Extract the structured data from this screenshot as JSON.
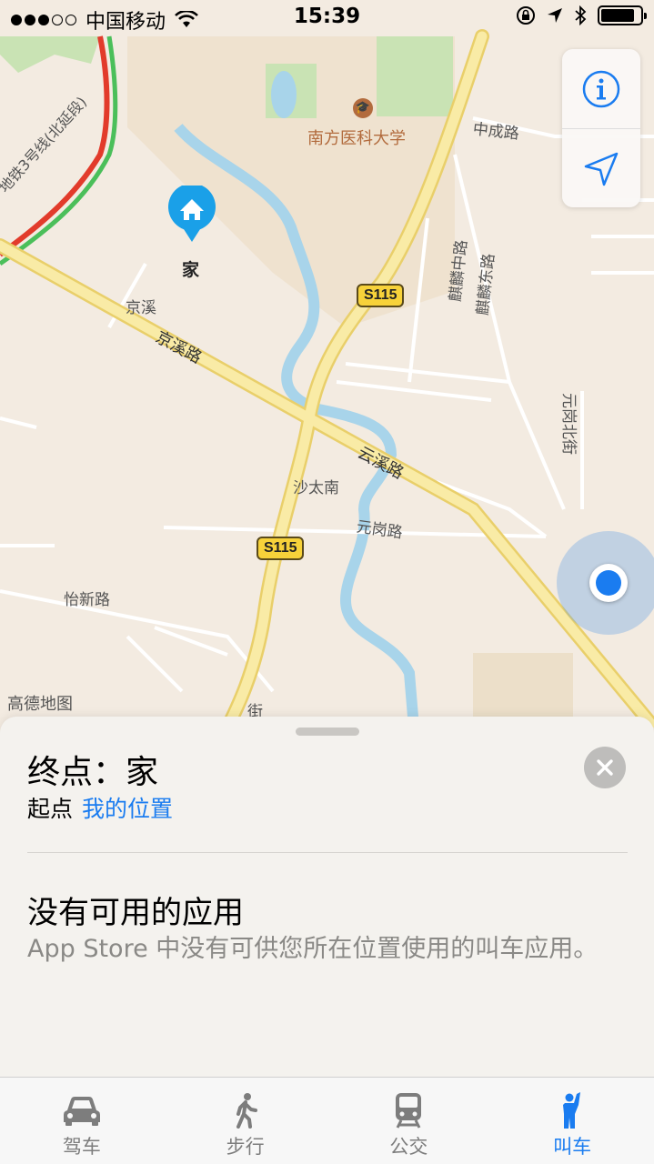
{
  "status_bar": {
    "carrier": "中国移动",
    "time": "15:39",
    "signal_full": 3,
    "signal_total": 5,
    "battery_level": 0.85
  },
  "map": {
    "labels": {
      "university": "南方医科大学",
      "zhongcheng_rd": "中成路",
      "metro_line": "地铁3号线(北延段)",
      "jingxi": "京溪",
      "jingxi_rd": "京溪路",
      "yunxi_rd": "云溪路",
      "shatainan": "沙太南",
      "yuangang_rd": "元岗路",
      "yixin_rd": "怡新路",
      "qilin_middle": "麒麟中路",
      "qilin_east": "麒麟东路",
      "yuangang_north": "元岗北街",
      "jie": "街",
      "home": "家"
    },
    "shields": [
      "S115",
      "S115"
    ],
    "attribution": "高德地图",
    "icons": {
      "info": "info-icon",
      "locate": "location-arrow-icon",
      "home": "home-icon",
      "university": "graduation-cap-icon"
    },
    "colors": {
      "water": "#a8d4ea",
      "road": "#f6e28a",
      "green": "#c9e3b4",
      "user_dot": "#1a7cf0"
    }
  },
  "sheet": {
    "destination_title": "终点：家",
    "origin_prefix": "起点",
    "origin_value": "我的位置",
    "no_app_title": "没有可用的应用",
    "no_app_desc": "App Store 中没有可供您所在位置使用的叫车应用。"
  },
  "tabbar": {
    "tabs": [
      {
        "label": "驾车",
        "icon": "car-icon",
        "active": false
      },
      {
        "label": "步行",
        "icon": "walk-icon",
        "active": false
      },
      {
        "label": "公交",
        "icon": "train-icon",
        "active": false
      },
      {
        "label": "叫车",
        "icon": "ride-hail-icon",
        "active": true
      }
    ],
    "active_color": "#1a7cf0",
    "inactive_color": "#7d7d7d"
  }
}
